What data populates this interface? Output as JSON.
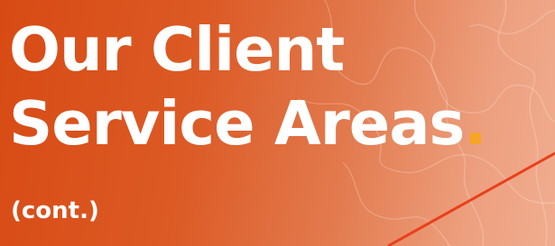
{
  "banner": {
    "title_line1": "Our Client",
    "title_line2": "Service Areas",
    "title_period": ".",
    "subtitle": "(cont.)"
  },
  "colors": {
    "background_start": "#d84a14",
    "background_end": "#f0ad90",
    "title_text": "#ffffff",
    "period_accent": "#f6a623",
    "accent_line": "#e8401c"
  }
}
